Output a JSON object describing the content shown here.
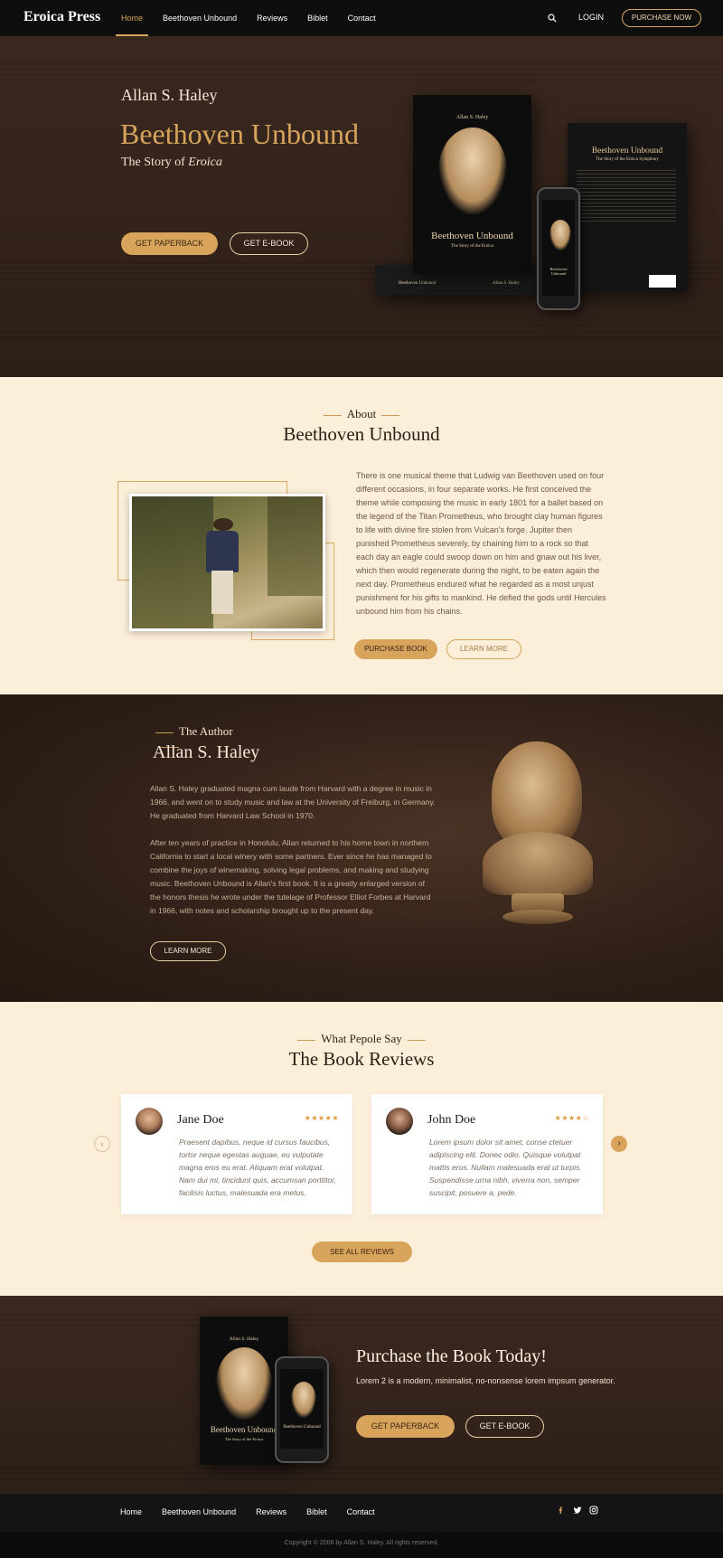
{
  "nav": {
    "logo": "Eroica Press",
    "links": [
      "Home",
      "Beethoven Unbound",
      "Reviews",
      "Biblet",
      "Contact"
    ],
    "login": "LOGIN",
    "cta": "PURCHASE NOW"
  },
  "hero": {
    "author": "Allan S. Haley",
    "title": "Beethoven Unbound",
    "subtitle_prefix": "The Story of",
    "subtitle_em": "Eroica",
    "btn_paperback": "GET PAPERBACK",
    "btn_ebook": "GET E-BOOK",
    "book_author": "Allan S. Haley",
    "book_title": "Beethoven Unbound",
    "book_sub": "The Story of the Eroica",
    "back_title": "Beethoven Unbound",
    "back_sub": "The Story of the Eroica Symphony"
  },
  "about": {
    "kicker": "About",
    "title": "Beethoven Unbound",
    "text": "There is one musical theme that Ludwig van Beethoven used on four different occasions, in four separate works.  He first conceived the theme while composing the music in early 1801 for a ballet based on the legend of the Titan Prometheus, who brought clay human figures to life with divine fire stolen from Vulcan's forge.  Jupiter then punished Prometheus severely, by chaining him to a rock so that each day an eagle could swoop down on him and gnaw out his liver, which then would regenerate during the night, to be eaten again the next day. Prometheus endured what he regarded as a most unjust punishment for his gifts to mankind.  He defied the gods until Hercules unbound him from his chains.",
    "btn_purchase": "PURCHASE BOOK",
    "btn_learn": "LEARN MORE"
  },
  "author": {
    "kicker": "The Author",
    "name": "Allan S. Haley",
    "para1": "Allan S. Haley graduated magna cum laude from Harvard with a degree in music in 1966, and went on to study music and law at the University of Freiburg, in Germany. He graduated from Harvard Law School in 1970.",
    "para2": "After ten years of practice in Honolulu, Allan returned to his home town in northern California to start a local winery with some partners.  Ever since he has managed to combine the joys of winemaking, solving legal problems, and making and studying music. Beethoven Unbound is Allan's first book. It is a greatly enlarged version of the honors thesis he wrote under the tutelage of Professor Elliot Forbes at Harvard in 1966, with notes and scholarship brought up to the present day.",
    "btn": "LEARN MORE"
  },
  "reviews": {
    "kicker": "What Pepole Say",
    "title": "The Book Reviews",
    "items": [
      {
        "name": "Jane Doe",
        "stars": "★★★★★",
        "rating": 5,
        "text": "Praesent dapibus, neque id cursus faucibus, tortor neque egestas auguae, eu vulputate magna eros eu erat. Aliquam erat volutpat. Nam dui mi, tincidunt quis, accumsan porttitor, facilisis luctus, malesuada era metus."
      },
      {
        "name": "John Doe",
        "stars": "★★★★☆",
        "rating": 4,
        "text": "Lorem ipsum dolor sit amet, conse  ctetuer adipiscing elit. Donec odio. Quisque volutpat mattis eros. Nullam malesuada erat ut turpis. Suspendisse urna nibh, viverra non, semper suscipit, posuere a, pede."
      }
    ],
    "see_all": "SEE ALL REVIEWS",
    "prev": "‹",
    "next": "›"
  },
  "purchase": {
    "title": "Purchase the Book Today!",
    "sub": "Lorem 2 is a modern, minimalist, no-nonsense lorem impsum generator.",
    "btn_paperback": "GET PAPERBACK",
    "btn_ebook": "GET E-BOOK"
  },
  "footer": {
    "links": [
      "Home",
      "Beethoven Unbound",
      "Reviews",
      "Biblet",
      "Contact"
    ],
    "social": [
      "f",
      "t",
      "o"
    ],
    "copyright": "Copyright © 2006 by Allan S. Haley. All rights reserved."
  },
  "colors": {
    "accent": "#d7a45c",
    "dark": "#2d1f18",
    "cream": "#fcefd9"
  }
}
